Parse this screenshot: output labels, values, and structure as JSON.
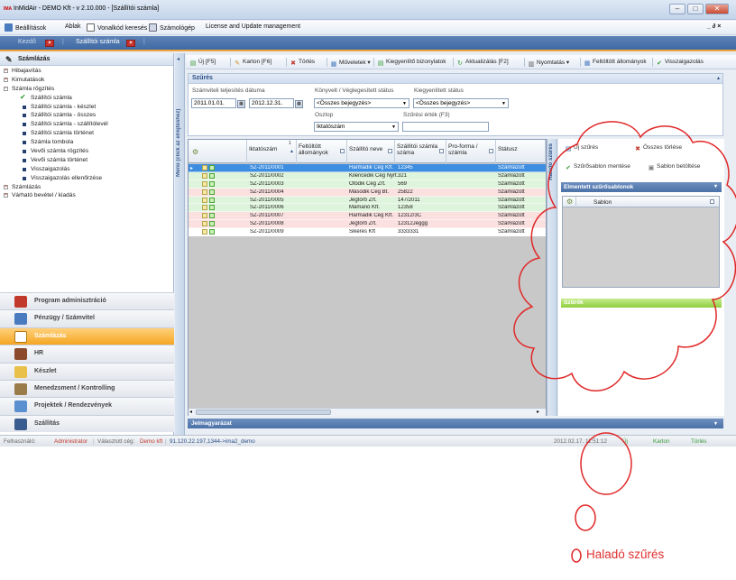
{
  "window": {
    "title": "InMidAir - DEMO Kft - v 2.10.000 - [Szállítói számla]",
    "min": "–",
    "max": "□",
    "close": "✕"
  },
  "menubar": {
    "items": [
      "Beállítások",
      "Ablak",
      "Vonalkód keresés",
      "Számológép",
      "License and Update management"
    ],
    "right": "_ ∂ ×"
  },
  "tabs": [
    {
      "label": "Kezdő",
      "active": false
    },
    {
      "label": "Szállítói számla",
      "active": true
    }
  ],
  "left_panel": {
    "title": "Számlázás",
    "tree": [
      {
        "label": "Hibajavítás",
        "level": 0,
        "type": "plus"
      },
      {
        "label": "Kimutatások",
        "level": 0,
        "type": "plus"
      },
      {
        "label": "Számla rögzítés",
        "level": 0,
        "type": "minus"
      },
      {
        "label": "Szállítói számla",
        "level": 1,
        "type": "check"
      },
      {
        "label": "Szállítói számla - készlet",
        "level": 1,
        "type": "sq"
      },
      {
        "label": "Szállítói számla - összes",
        "level": 1,
        "type": "sq"
      },
      {
        "label": "Szállítói számla - szállítólevél",
        "level": 1,
        "type": "sq"
      },
      {
        "label": "Szállítói számla történet",
        "level": 1,
        "type": "sq"
      },
      {
        "label": "Számla tombola",
        "level": 1,
        "type": "sq"
      },
      {
        "label": "Vevői számla rögzítés",
        "level": 1,
        "type": "sq"
      },
      {
        "label": "Vevői számla történet",
        "level": 1,
        "type": "sq"
      },
      {
        "label": "Visszaigazolás",
        "level": 1,
        "type": "sq"
      },
      {
        "label": "Visszaigazolás ellenőrzése",
        "level": 1,
        "type": "sq"
      },
      {
        "label": "Számlázás",
        "level": 0,
        "type": "plus"
      },
      {
        "label": "Várható bevétel / kiadás",
        "level": 0,
        "type": "plus"
      }
    ],
    "modules": [
      {
        "label": "Program adminisztráció",
        "active": false,
        "color": "#c0392b"
      },
      {
        "label": "Pénzügy / Számvitel",
        "active": false,
        "color": "#4a7bbf"
      },
      {
        "label": "Számlázás",
        "active": true,
        "color": "#ffffff"
      },
      {
        "label": "HR",
        "active": false,
        "color": "#8a4a2b"
      },
      {
        "label": "Készlet",
        "active": false,
        "color": "#e8c04a"
      },
      {
        "label": "Menedzsment / Kontrolling",
        "active": false,
        "color": "#9a7b4a"
      },
      {
        "label": "Projektek / Rendezvények",
        "active": false,
        "color": "#5a8fd0"
      },
      {
        "label": "Szállítás",
        "active": false,
        "color": "#3a5d8f"
      }
    ]
  },
  "side_tab": "Menü (click az elrejtéshez)",
  "toolbar": [
    {
      "label": "Új  [F5]",
      "icon": "new-icon",
      "color": "#3a9a3a"
    },
    {
      "label": "Karton  [F6]",
      "icon": "edit-icon",
      "color": "#c98a2a"
    },
    {
      "label": "Törlés",
      "icon": "delete-icon",
      "color": "#c0392b"
    },
    {
      "label": "Műveletek ▾",
      "icon": "actions-icon",
      "color": "#4a7bbf"
    },
    {
      "label": "Kiegyenlítő bizonylatok",
      "icon": "documents-icon",
      "color": "#3a9a3a"
    },
    {
      "label": "Aktualizálás  [F2]",
      "icon": "refresh-icon",
      "color": "#3a9a3a"
    },
    {
      "label": "Nyomtatás  ▾",
      "icon": "print-icon",
      "color": "#555555"
    },
    {
      "label": "Feltöltött állományok",
      "icon": "files-icon",
      "color": "#4a7bbf"
    },
    {
      "label": "Visszaigazolás",
      "icon": "confirm-icon",
      "color": "#3a9a3a"
    }
  ],
  "filter": {
    "title": "Szűrés",
    "date_label": "Számviteli teljesítés dátuma",
    "date_from": "2011.01.01.",
    "date_to": "2012.12.31.",
    "booked_label": "Könyvelt / Véglegesített státus",
    "booked_value": "<Összes bejegyzés>",
    "paid_label": "Kiegyenlített státus",
    "paid_value": "<Összes bejegyzés>",
    "column_label": "Oszlop",
    "column_value": "Iktatószám",
    "value_label": "Szűrési érték (F3)",
    "value_value": ""
  },
  "grid": {
    "columns": [
      "Iktatószám",
      "Feltöltött állományok",
      "Szállító neve",
      "Szállítói számla száma",
      "Pro-forma / számla",
      "Státusz"
    ],
    "sort_indicator": "1",
    "rows": [
      {
        "id": "SZ-2011/0001",
        "supplier": "Harmadik Cég Kft.",
        "invoice": "12345",
        "status": "Számlázott",
        "style": "sel"
      },
      {
        "id": "SZ-2011/0002",
        "supplier": "Kilencedik Cég Nyrt.",
        "invoice": "321",
        "status": "Számlázott",
        "style": "g"
      },
      {
        "id": "SZ-2011/0003",
        "supplier": "Ötödik Cég Zrt.",
        "invoice": "569",
        "status": "Számlázott",
        "style": "g"
      },
      {
        "id": "SZ-2011/0004",
        "supplier": "Második Cég Bt.",
        "invoice": "25822",
        "status": "Számlázott",
        "style": "p"
      },
      {
        "id": "SZ-2011/0005",
        "supplier": "Jégtörő Zrt.",
        "invoice": "147/2011",
        "status": "Számlázott",
        "style": "g"
      },
      {
        "id": "SZ-2011/0006",
        "supplier": "Mamanó Kft.",
        "invoice": "12358",
        "status": "Számlázott",
        "style": "g"
      },
      {
        "id": "SZ-2011/0007",
        "supplier": "Harmadik Cég Kft.",
        "invoice": "12312/3C",
        "status": "Számlázott",
        "style": "p"
      },
      {
        "id": "SZ-2011/0008",
        "supplier": "Jégtörő Zrt.",
        "invoice": "12312Jéggg",
        "status": "Számlázott",
        "style": "p"
      },
      {
        "id": "SZ-2011/0009",
        "supplier": "Sikeres Kft",
        "invoice": "3333331",
        "status": "Számlázott",
        "style": "w"
      }
    ]
  },
  "advanced": {
    "side_tab": "Haladó szűrés",
    "new_filter": "Új szűrés",
    "all_filters": "Összes törlése",
    "save_filter": "Szűrősablon mentése",
    "load_template": "Sablon betöltése",
    "saved_title": "Elmentett szűrősablonok",
    "saved_col": "Sablon",
    "filters_title": "Szűrők"
  },
  "legend": "Jelmagyarázat",
  "statusbar": {
    "user_label": "Felhasználó:",
    "user": "Administrator",
    "company_label": "Választott cég:",
    "company": "Demo kft",
    "server": "91.120.22.197,1344->ima2_demo",
    "datetime": "2012.02.17. 11:51:12",
    "new": "Új",
    "card": "Karton",
    "delete": "Törlés"
  },
  "annotation": {
    "text": "Haladó szűrés",
    "color": "#e03030"
  }
}
